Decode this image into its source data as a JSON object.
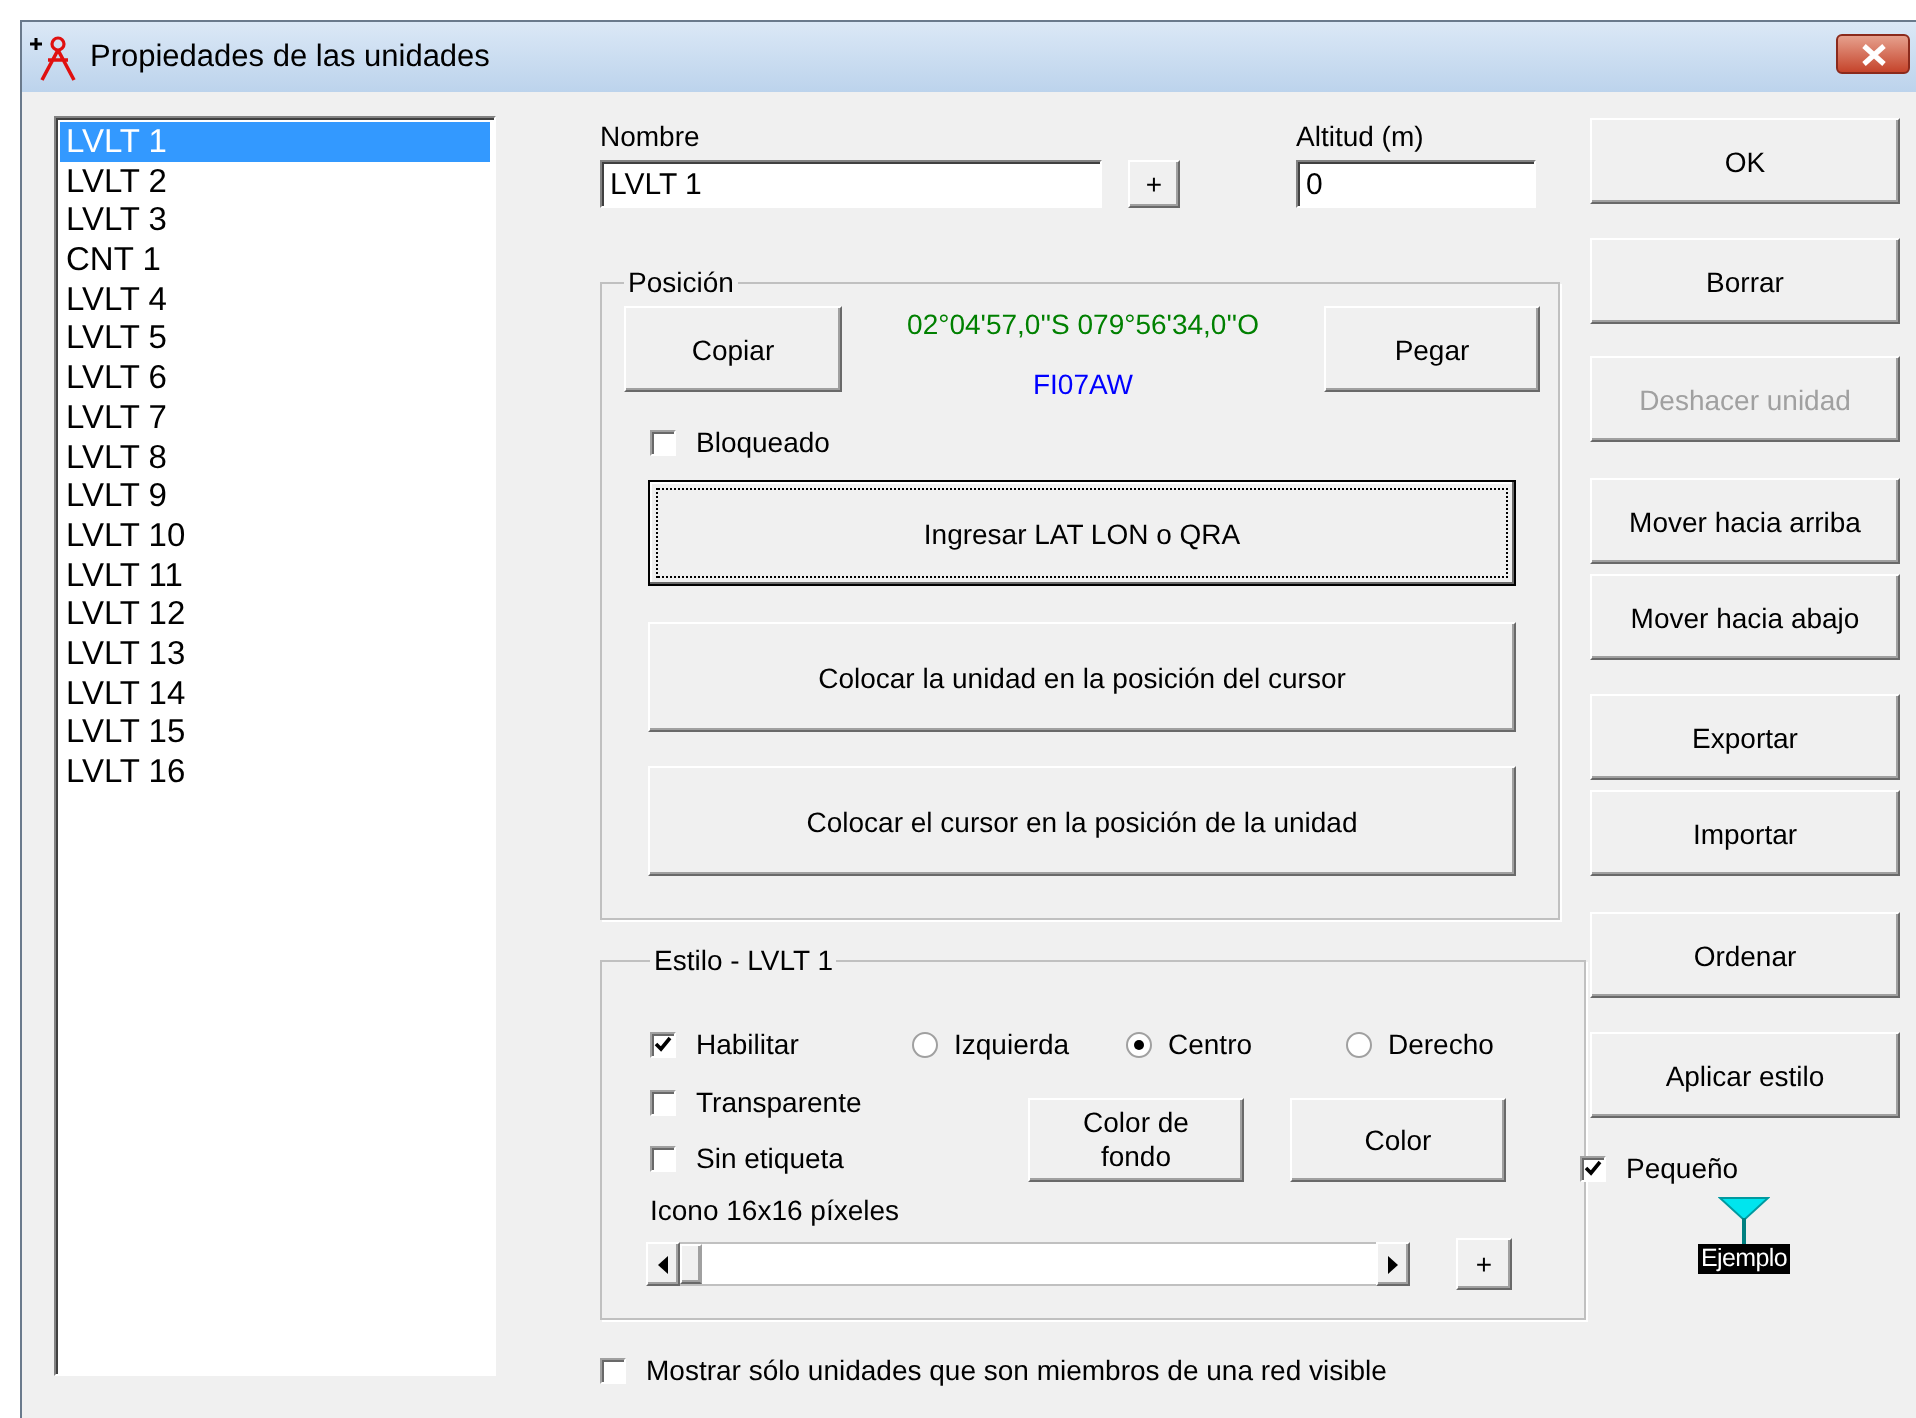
{
  "window": {
    "title": "Propiedades de las unidades"
  },
  "units": [
    {
      "label": "LVLT 1",
      "selected": true
    },
    {
      "label": "LVLT 2",
      "selected": false
    },
    {
      "label": "LVLT 3",
      "selected": false
    },
    {
      "label": "CNT 1",
      "selected": false
    },
    {
      "label": "LVLT 4",
      "selected": false
    },
    {
      "label": "LVLT 5",
      "selected": false
    },
    {
      "label": "LVLT 6",
      "selected": false
    },
    {
      "label": "LVLT 7",
      "selected": false
    },
    {
      "label": "LVLT 8",
      "selected": false
    },
    {
      "label": "LVLT 9",
      "selected": false
    },
    {
      "label": "LVLT 10",
      "selected": false
    },
    {
      "label": "LVLT 11",
      "selected": false
    },
    {
      "label": "LVLT 12",
      "selected": false
    },
    {
      "label": "LVLT 13",
      "selected": false
    },
    {
      "label": "LVLT 14",
      "selected": false
    },
    {
      "label": "LVLT 15",
      "selected": false
    },
    {
      "label": "LVLT 16",
      "selected": false
    }
  ],
  "name_field": {
    "label": "Nombre",
    "value": "LVLT 1"
  },
  "name_add_button": "+",
  "altitude_field": {
    "label": "Altitud (m)",
    "value": "0"
  },
  "position": {
    "title": "Posición",
    "copy_button": "Copiar",
    "coordinates": "02°04'57,0''S 079°56'34,0''O",
    "locator": "FI07AW",
    "paste_button": "Pegar",
    "locked": {
      "label": "Bloqueado",
      "checked": false
    },
    "actions": [
      {
        "label": "Ingresar LAT LON o QRA",
        "focused": true
      },
      {
        "label": "Colocar la unidad en la posición del cursor",
        "focused": false
      },
      {
        "label": "Colocar el cursor en la posición de la unidad",
        "focused": false
      }
    ]
  },
  "style": {
    "title": "Estilo - LVLT 1",
    "enable": {
      "label": "Habilitar",
      "checked": true
    },
    "alignment": [
      {
        "label": "Izquierda",
        "selected": false
      },
      {
        "label": "Centro",
        "selected": true
      },
      {
        "label": "Derecho",
        "selected": false
      }
    ],
    "options": [
      {
        "label": "Transparente",
        "checked": false
      },
      {
        "label": "Sin etiqueta",
        "checked": false
      }
    ],
    "color_buttons": [
      "Color de fondo",
      "Color"
    ],
    "icon_size_label": "Icono 16x16 píxeles",
    "add_button": "+"
  },
  "show_only_visible": {
    "label": "Mostrar sólo unidades que son miembros de una red visible",
    "checked": false
  },
  "buttons": [
    {
      "label": "OK",
      "disabled": false
    },
    {
      "label": "Borrar",
      "disabled": false
    },
    {
      "label": "Deshacer unidad",
      "disabled": true
    },
    {
      "label": "Mover hacia arriba",
      "disabled": false
    },
    {
      "label": "Mover hacia abajo",
      "disabled": false
    },
    {
      "label": "Exportar",
      "disabled": false
    },
    {
      "label": "Importar",
      "disabled": false
    },
    {
      "label": "Ordenar",
      "disabled": false
    },
    {
      "label": "Aplicar estilo",
      "disabled": false
    }
  ],
  "small": {
    "label": "Pequeño",
    "checked": true
  },
  "example_label": "Ejemplo"
}
